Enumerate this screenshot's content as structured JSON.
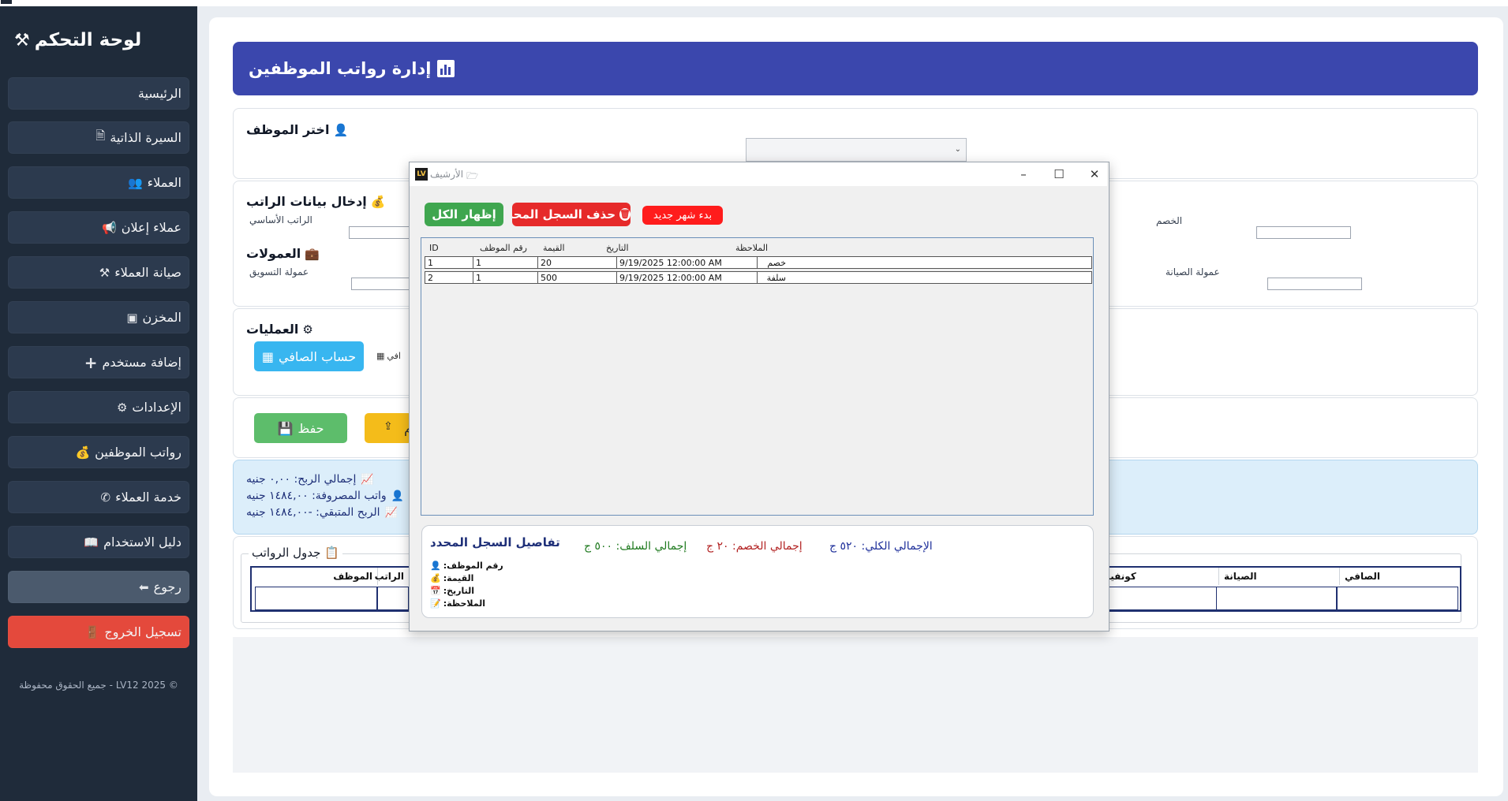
{
  "sidebar": {
    "title": "لوحة التحكم",
    "items": [
      {
        "label": "الرئيسية",
        "icon": ""
      },
      {
        "label": "السيرة الذاتية",
        "icon": "document-icon"
      },
      {
        "label": "العملاء",
        "icon": "users-icon"
      },
      {
        "label": "عملاء إعلان",
        "icon": "megaphone-icon"
      },
      {
        "label": "صيانة العملاء",
        "icon": "tools-icon"
      },
      {
        "label": "المخزن",
        "icon": "box-icon"
      },
      {
        "label": "إضافة مستخدم",
        "icon": "plus-icon"
      },
      {
        "label": "الإعدادات",
        "icon": "gear-icon"
      },
      {
        "label": "رواتب الموظفين",
        "icon": "money-bag-icon"
      },
      {
        "label": "خدمة العملاء",
        "icon": "phone-icon"
      },
      {
        "label": "دليل الاستخدام",
        "icon": "book-icon"
      },
      {
        "label": "رجوع",
        "icon": "arrow-left-icon"
      },
      {
        "label": "تسجيل الخروج",
        "icon": "door-icon"
      }
    ],
    "footer": "© 2025 LV12 - جميع الحقوق محفوظة"
  },
  "header": {
    "title": "إدارة رواتب الموظفين"
  },
  "employee_section": {
    "title": "اختر الموظف"
  },
  "salary_section": {
    "title": "إدخال بيانات الراتب",
    "basic_label": "الراتب الأساسي",
    "deduction_label": "الخصم"
  },
  "commissions_section": {
    "title": "العمولات",
    "marketing_label": "عمولة التسويق",
    "maintenance_label": "عمولة الصيانة"
  },
  "operations_section": {
    "title": "العمليات",
    "calc_net_label": "حساب الصافي",
    "net_fragment": "افي"
  },
  "actions": {
    "save_label": "حفظ",
    "yellow_fragment": "م"
  },
  "summary": {
    "total_profit": "إجمالي الربح: ٠,٠٠ جنيه",
    "salaries_paid": "واتب المصروفة: ١٤٨٤,٠٠ جنيه",
    "remaining_profit": "الربح المتبقي: -١٤٨٤,٠٠ جنيه"
  },
  "salary_table": {
    "title": "جدول الرواتب",
    "headers": {
      "employee": "الموظف",
      "salary": "الراتب",
      "confirm": "كونفيرم",
      "maintenance": "الصيانة",
      "net": "الصافي"
    }
  },
  "archive_dialog": {
    "title": "الأرشيف",
    "show_all_label": "إظهار الكل",
    "delete_label": "حذف السجل المحدد",
    "new_month_label": "بدء شهر جديد",
    "grid": {
      "headers": [
        "ID",
        "رقم الموظف",
        "القيمة",
        "التاريخ",
        "الملاحظة"
      ],
      "rows": [
        [
          "1",
          "1",
          "20",
          "9/19/2025 12:00:00 AM",
          "خصم"
        ],
        [
          "2",
          "1",
          "500",
          "9/19/2025 12:00:00 AM",
          "سلفة"
        ]
      ]
    },
    "details": {
      "title": "تفاصيل السجل المحدد",
      "employee_no_label": "رقم الموظف:",
      "value_label": "القيمة:",
      "date_label": "التاريخ:",
      "note_label": "الملاحظة:",
      "grand_total": "الإجمالي الكلي: ٥٢٠ ج",
      "total_deductions": "إجمالي الخصم: ٢٠ ج",
      "total_advances": "إجمالي السلف: ٥٠٠ ج"
    }
  },
  "colors": {
    "sidebar_bg": "#1f2b3a",
    "header_bg": "#3b47ad",
    "logout_bg": "#e4493c",
    "show_all_bg": "#3fa64f",
    "delete_bg": "#e62a2a",
    "new_month_bg": "#ff1c1c",
    "calc_btn_bg": "#38b6f0",
    "save_btn_bg": "#5dbd6b",
    "yellow_btn_bg": "#f4bc1a"
  }
}
